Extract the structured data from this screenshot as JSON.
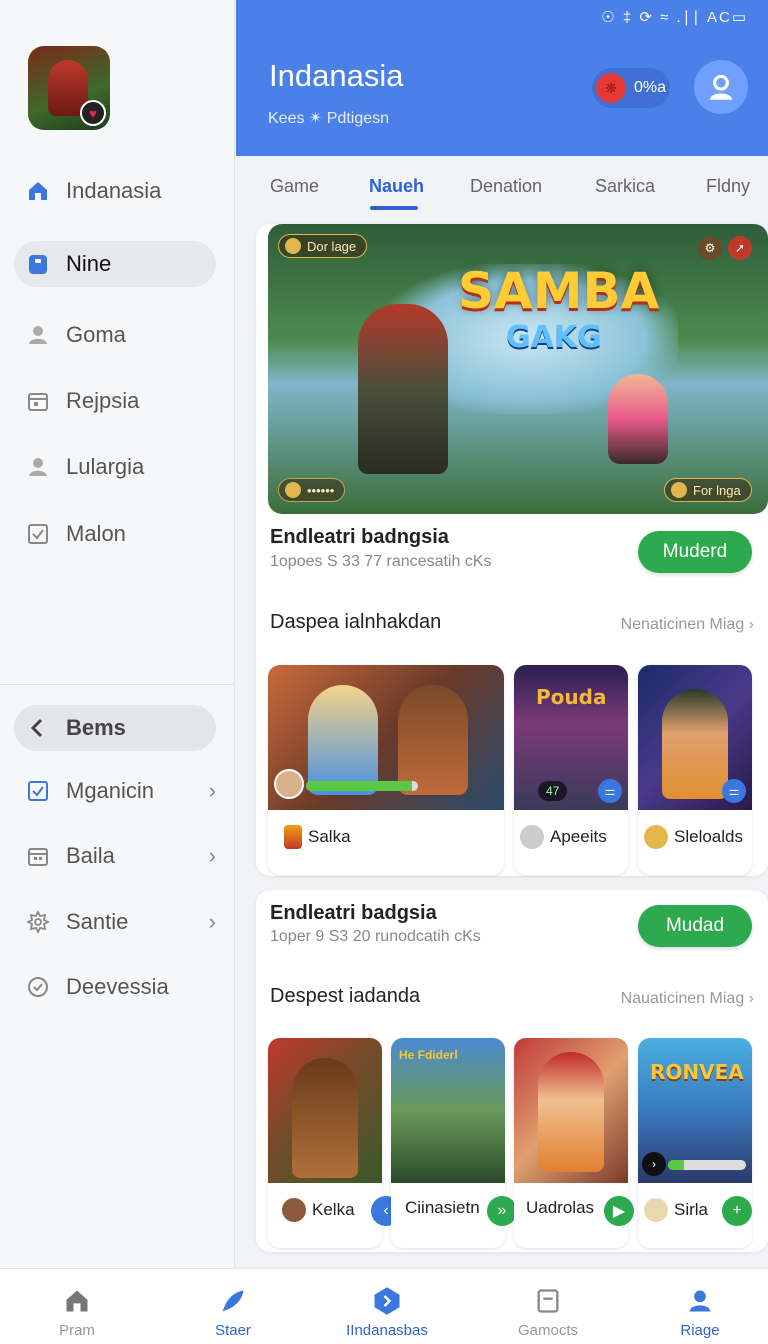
{
  "status_bar": "☉ ‡ ⟳ ≈ .∣∣ AC▭",
  "sidebar": {
    "items": [
      {
        "label": "Indanasia",
        "icon": "home-icon"
      },
      {
        "label": "Nine",
        "icon": "badge-icon"
      },
      {
        "label": "Goma",
        "icon": "person-icon"
      },
      {
        "label": "Rejpsia",
        "icon": "calendar-icon"
      },
      {
        "label": "Lulargia",
        "icon": "person-icon"
      },
      {
        "label": "Malon",
        "icon": "checkbox-icon"
      }
    ],
    "back_label": "Bems",
    "lower_items": [
      {
        "label": "Mganicin",
        "icon": "checkbox-icon"
      },
      {
        "label": "Baila",
        "icon": "calendar-icon"
      },
      {
        "label": "Santie",
        "icon": "gear-icon"
      },
      {
        "label": "Deevessia",
        "icon": "clock-icon"
      }
    ]
  },
  "header": {
    "title": "Indanasia",
    "subtitle": "Kees ✴ Pdtigesn",
    "coins": "0%a"
  },
  "tabs": [
    "Game",
    "Naueh",
    "Denation",
    "Sarkica",
    "Fldny"
  ],
  "active_tab": "Naueh",
  "card1": {
    "hero_chip": "Dor lage",
    "hero_logo": "SAMBA",
    "hero_logo_sub": "GAKG",
    "hero_progress_text": "••••••",
    "hero_chip2": "For lnga",
    "title": "Endleatri badngsia",
    "subtitle": "1opoes S  33 77 rancesatih cKs",
    "button": "Muderd",
    "section_title": "Daspea ialnhakdan",
    "section_link": "Nenaticinen Miag ›",
    "tiles": [
      {
        "label": "Salka",
        "progress": 0.95
      },
      {
        "label": "Apeeits",
        "thumb_text": "Pouda",
        "small": "47"
      },
      {
        "label": "Sleloalds"
      }
    ]
  },
  "card2": {
    "title": "Endleatri badgsia",
    "subtitle": "1oper 9  S3 20 runodcatih cKs",
    "button": "Mudad",
    "section_title": "Despest iadanda",
    "section_link": "Nauaticinen Miag ›",
    "tiles": [
      {
        "label": "Kelka"
      },
      {
        "label": "Ciinasietn",
        "thumb_text": "He Fdiderl"
      },
      {
        "label": "Uadrolas"
      },
      {
        "label": "Sirla",
        "thumb_text": "RONVEA",
        "progress": 0.2
      }
    ]
  },
  "bottom_nav": [
    {
      "label": "Pram",
      "icon": "home-icon"
    },
    {
      "label": "Staer",
      "icon": "rocket-icon"
    },
    {
      "label": "IIndanasbas",
      "icon": "play-icon"
    },
    {
      "label": "Gamocts",
      "icon": "document-icon"
    },
    {
      "label": "Riage",
      "icon": "profile-icon"
    }
  ],
  "colors": {
    "accent": "#4a80e8",
    "green": "#2eaa4e",
    "active_blue": "#2d63d6"
  }
}
